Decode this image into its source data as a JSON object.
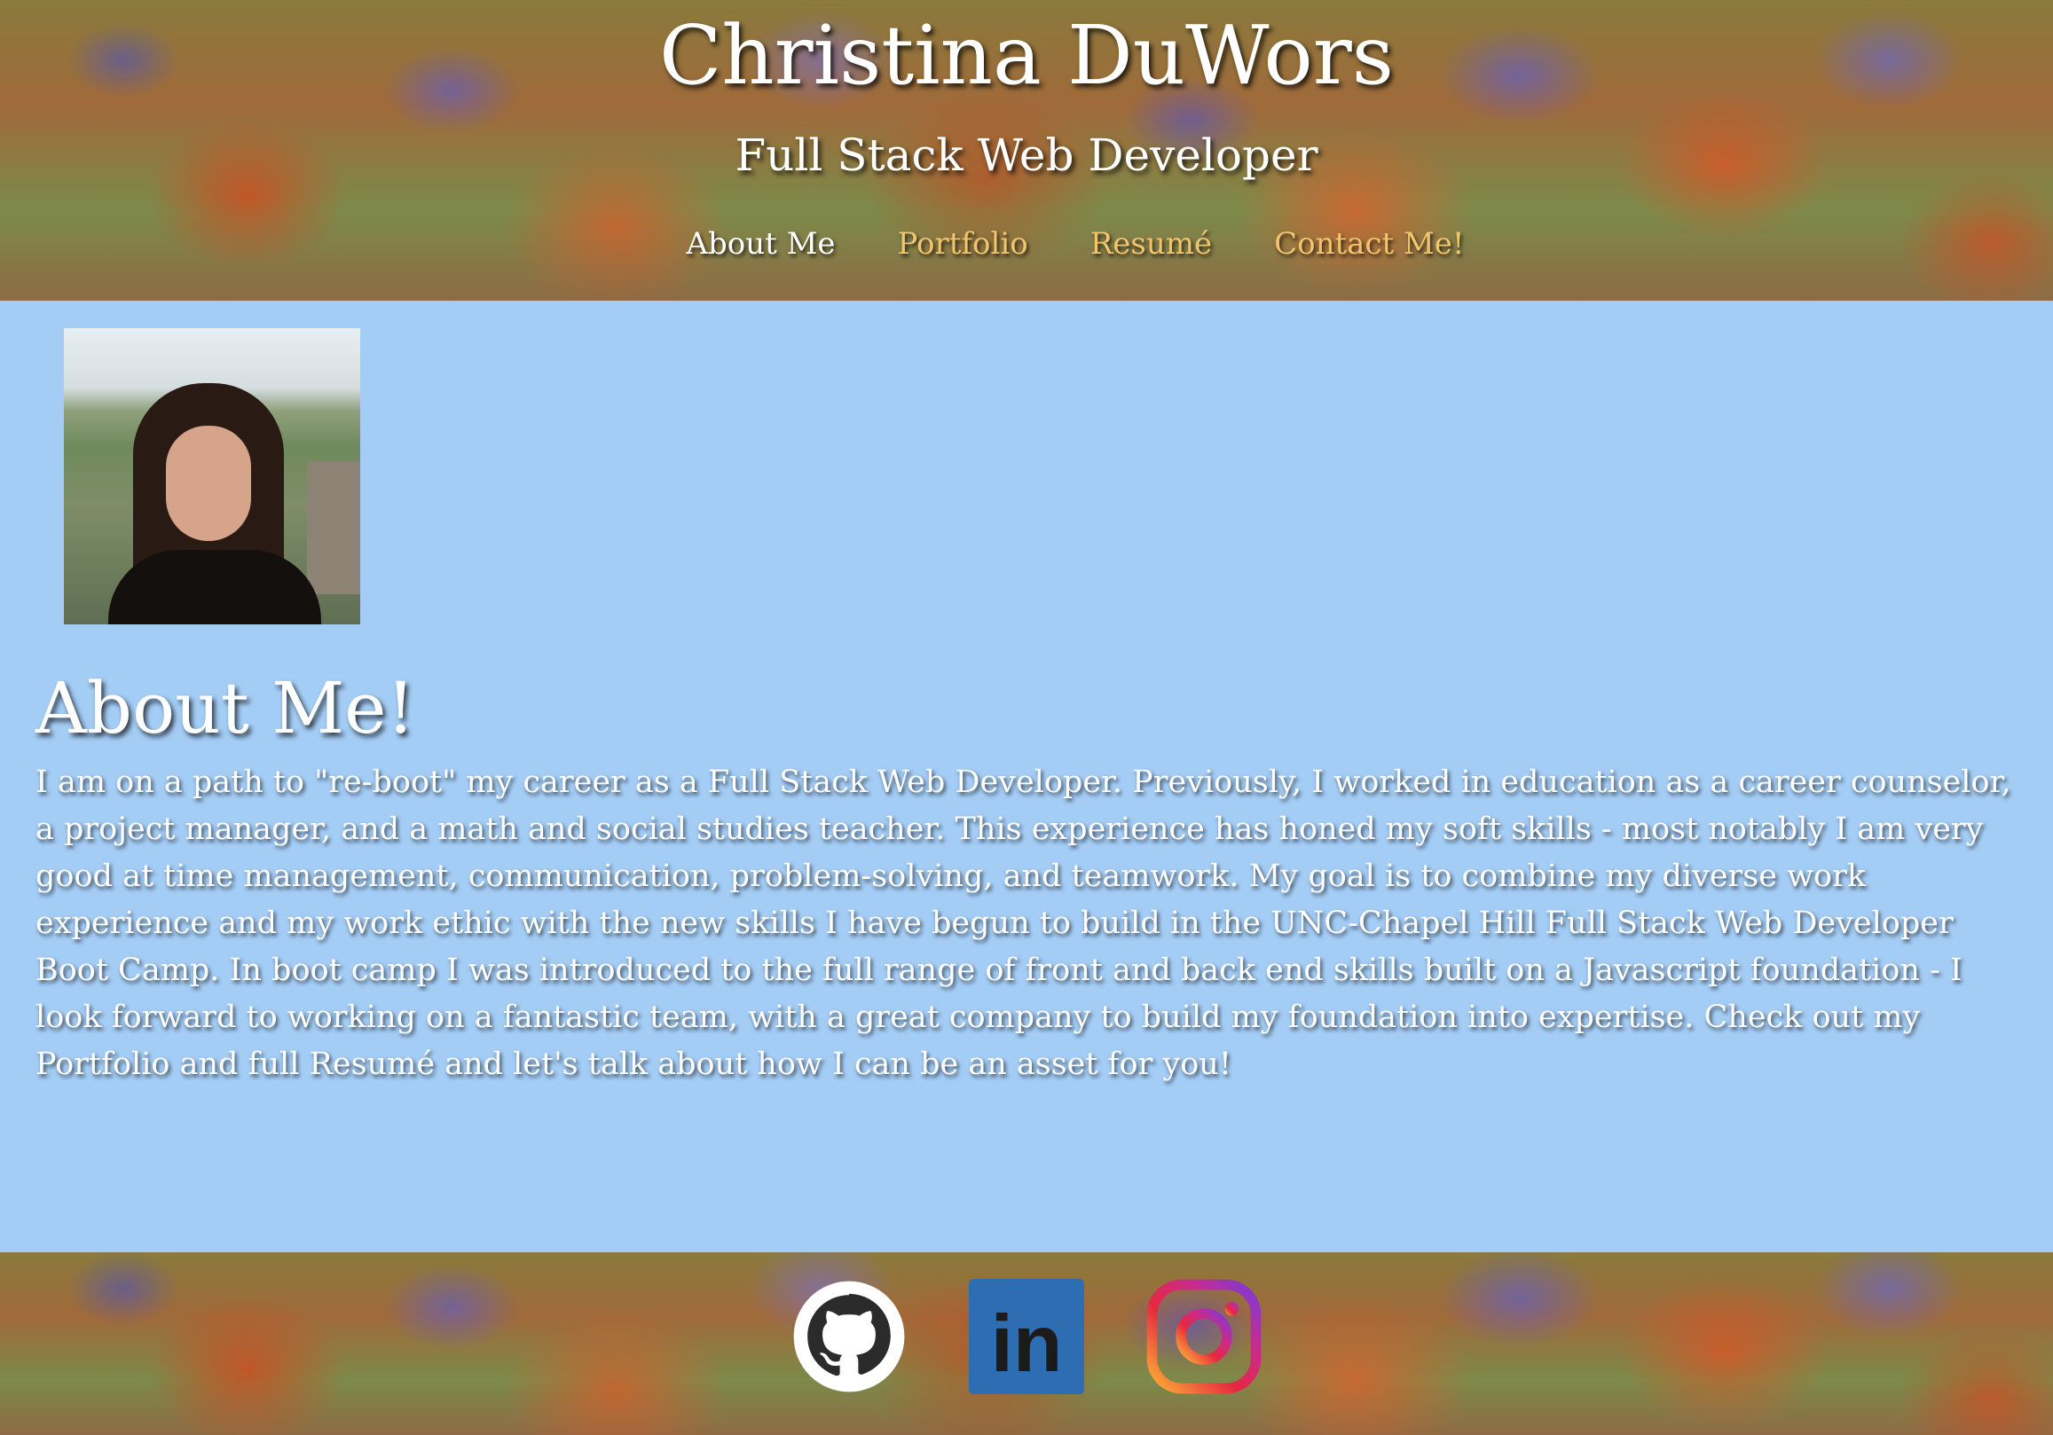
{
  "header": {
    "name": "Christina DuWors",
    "subtitle": "Full Stack Web Developer"
  },
  "nav": {
    "items": [
      {
        "label": "About Me",
        "active": true
      },
      {
        "label": "Portfolio",
        "active": false
      },
      {
        "label": "Resumé",
        "active": false
      },
      {
        "label": "Contact Me!",
        "active": false
      }
    ]
  },
  "about": {
    "heading": "About Me!",
    "text": "I am on a path to \"re-boot\" my career as a Full Stack Web Developer. Previously, I worked in education as a career counselor, a project manager, and a math and social studies teacher. This experience has honed my soft skills - most notably I am very good at time management, communication, problem-solving, and teamwork. My goal is to combine my diverse work experience and my work ethic with the new skills I have begun to build in the UNC-Chapel Hill Full Stack Web Developer Boot Camp. In boot camp I was introduced to the full range of front and back end skills built on a Javascript foundation - I look forward to working on a fantastic team, with a great company to build my foundation into expertise. Check out my Portfolio and full Resumé and let's talk about how I can be an asset for you!"
  },
  "footer": {
    "socials": [
      {
        "icon": "github-icon"
      },
      {
        "icon": "linkedin-icon",
        "text": "in"
      },
      {
        "icon": "instagram-icon"
      }
    ]
  },
  "colors": {
    "main_bg": "#a4cdf6",
    "nav_active": "#ffffff",
    "nav_inactive": "#f1c46e",
    "linkedin_blue": "#2f6db3"
  }
}
